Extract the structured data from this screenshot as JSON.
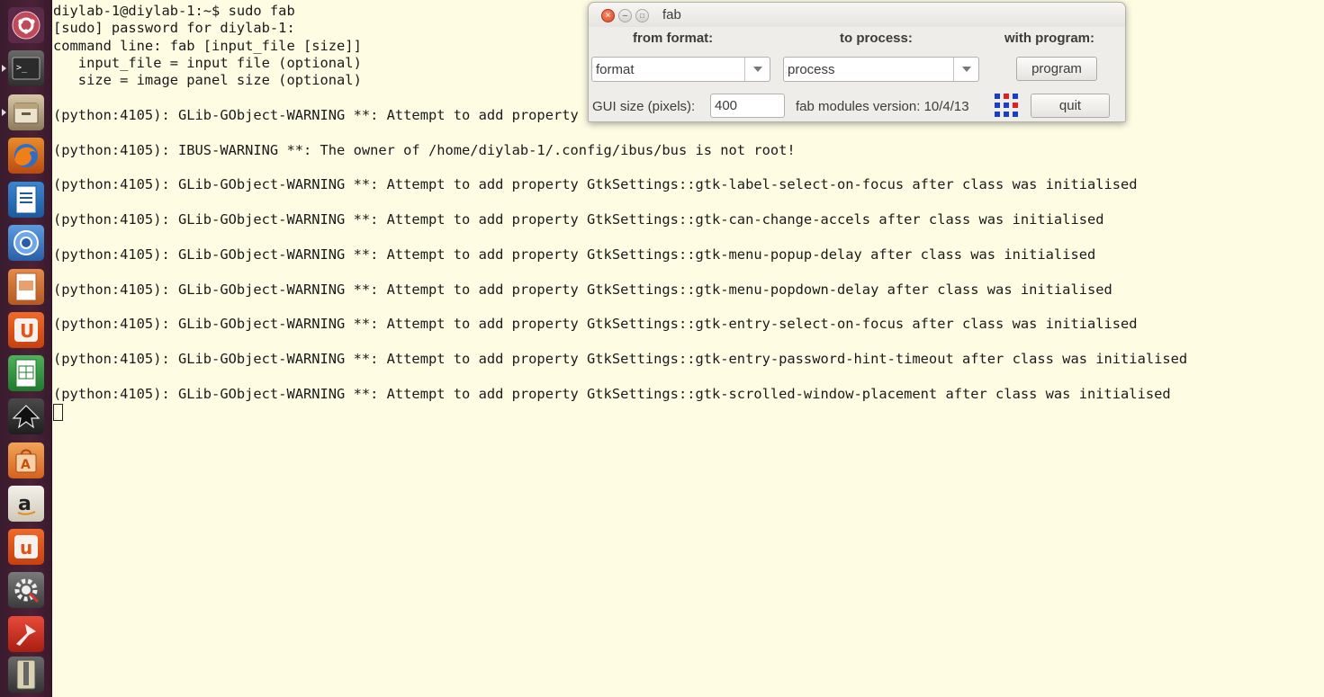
{
  "terminal": {
    "lines": [
      "diylab-1@diylab-1:~$ sudo fab",
      "[sudo] password for diylab-1:",
      "command line: fab [input_file [size]]",
      "   input_file = input file (optional)",
      "   size = image panel size (optional)",
      "",
      "(python:4105): GLib-GObject-WARNING **: Attempt to add property",
      "",
      "(python:4105): IBUS-WARNING **: The owner of /home/diylab-1/.config/ibus/bus is not root!",
      "",
      "(python:4105): GLib-GObject-WARNING **: Attempt to add property GtkSettings::gtk-label-select-on-focus after class was initialised",
      "",
      "(python:4105): GLib-GObject-WARNING **: Attempt to add property GtkSettings::gtk-can-change-accels after class was initialised",
      "",
      "(python:4105): GLib-GObject-WARNING **: Attempt to add property GtkSettings::gtk-menu-popup-delay after class was initialised",
      "",
      "(python:4105): GLib-GObject-WARNING **: Attempt to add property GtkSettings::gtk-menu-popdown-delay after class was initialised",
      "",
      "(python:4105): GLib-GObject-WARNING **: Attempt to add property GtkSettings::gtk-entry-select-on-focus after class was initialised",
      "",
      "(python:4105): GLib-GObject-WARNING **: Attempt to add property GtkSettings::gtk-entry-password-hint-timeout after class was initialised",
      "",
      "(python:4105): GLib-GObject-WARNING **: Attempt to add property GtkSettings::gtk-scrolled-window-placement after class was initialised"
    ]
  },
  "fab": {
    "title": "fab",
    "from_format_label": "from format:",
    "to_process_label": "to process:",
    "with_program_label": "with program:",
    "format_value": "format",
    "process_value": "process",
    "program_button": "program",
    "gui_size_label": "GUI size (pixels):",
    "gui_size_value": "400",
    "version_text": "fab modules version: 10/4/13",
    "quit_button": "quit"
  },
  "launcher": {
    "items": [
      "dash-icon",
      "terminal-icon",
      "files-icon",
      "firefox-icon",
      "writer-icon",
      "chromium-icon",
      "impress-icon",
      "ubuntu-one-icon",
      "calc-icon",
      "inkscape-icon",
      "software-center-icon",
      "amazon-icon",
      "ubuntu-one-music-icon",
      "system-settings-icon",
      "tool-icon",
      "archive-icon"
    ]
  },
  "colors": {
    "terminal_bg": "#fefde4",
    "launcher_bg": "#4a2238",
    "dialog_bg": "#efedea",
    "close_button": "#e0532b"
  }
}
